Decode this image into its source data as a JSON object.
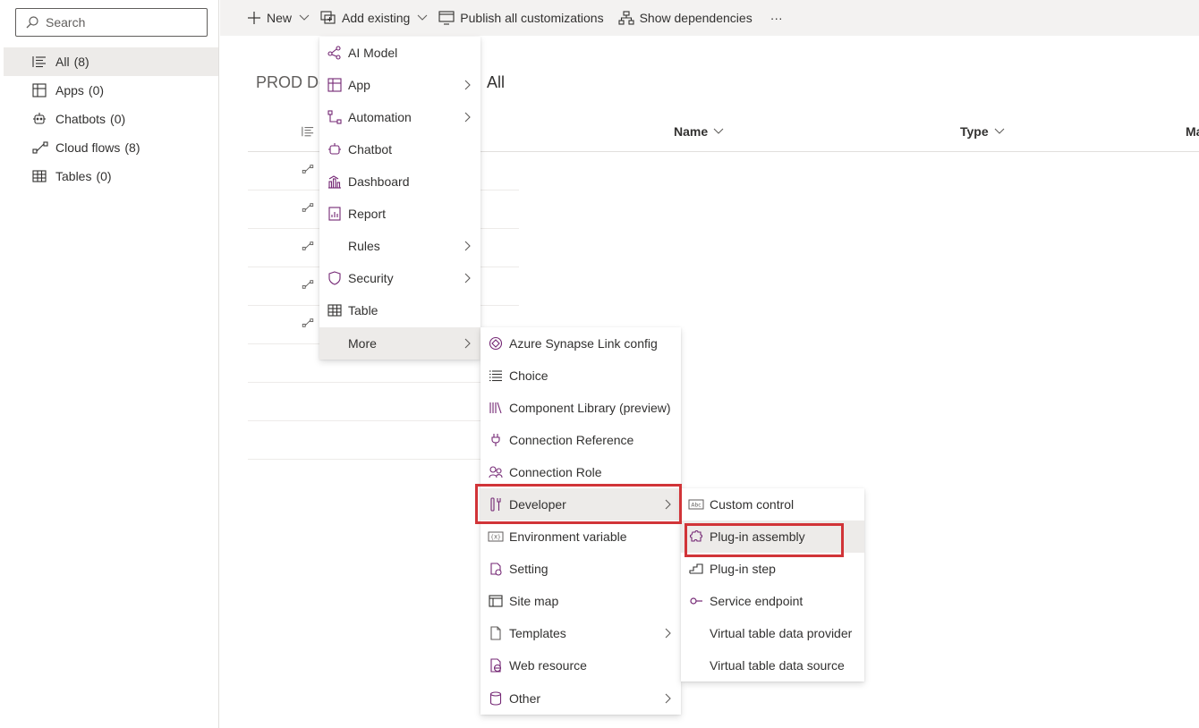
{
  "sidebar": {
    "search_placeholder": "Search",
    "items": [
      {
        "label": "All",
        "count": "(8)",
        "icon": "list-icon"
      },
      {
        "label": "Apps",
        "count": "(0)",
        "icon": "apps-icon"
      },
      {
        "label": "Chatbots",
        "count": "(0)",
        "icon": "chatbot-icon"
      },
      {
        "label": "Cloud flows",
        "count": "(8)",
        "icon": "flow-icon"
      },
      {
        "label": "Tables",
        "count": "(0)",
        "icon": "table-icon"
      }
    ]
  },
  "toolbar": {
    "new_label": "New",
    "add_existing_label": "Add existing",
    "publish_label": "Publish all customizations",
    "dependencies_label": "Show dependencies",
    "more_label": "···"
  },
  "breadcrumb": {
    "solution": "PROD De",
    "current": "All"
  },
  "grid": {
    "columns": [
      "Name",
      "Type",
      "Ma"
    ]
  },
  "menu_add_existing": [
    {
      "label": "AI Model"
    },
    {
      "label": "App"
    },
    {
      "label": "Automation"
    },
    {
      "label": "Chatbot"
    },
    {
      "label": "Dashboard"
    },
    {
      "label": "Report"
    },
    {
      "label": "Rules"
    },
    {
      "label": "Security"
    },
    {
      "label": "Table"
    },
    {
      "label": "More"
    }
  ],
  "menu_more": [
    {
      "label": "Azure Synapse Link config"
    },
    {
      "label": "Choice"
    },
    {
      "label": "Component Library (preview)"
    },
    {
      "label": "Connection Reference"
    },
    {
      "label": "Connection Role"
    },
    {
      "label": "Developer"
    },
    {
      "label": "Environment variable"
    },
    {
      "label": "Setting"
    },
    {
      "label": "Site map"
    },
    {
      "label": "Templates"
    },
    {
      "label": "Web resource"
    },
    {
      "label": "Other"
    }
  ],
  "menu_developer": [
    {
      "label": "Custom control"
    },
    {
      "label": "Plug-in assembly"
    },
    {
      "label": "Plug-in step"
    },
    {
      "label": "Service endpoint"
    },
    {
      "label": "Virtual table data provider"
    },
    {
      "label": "Virtual table data source"
    }
  ],
  "colors": {
    "accent": "#742774",
    "highlight": "#d13438"
  }
}
